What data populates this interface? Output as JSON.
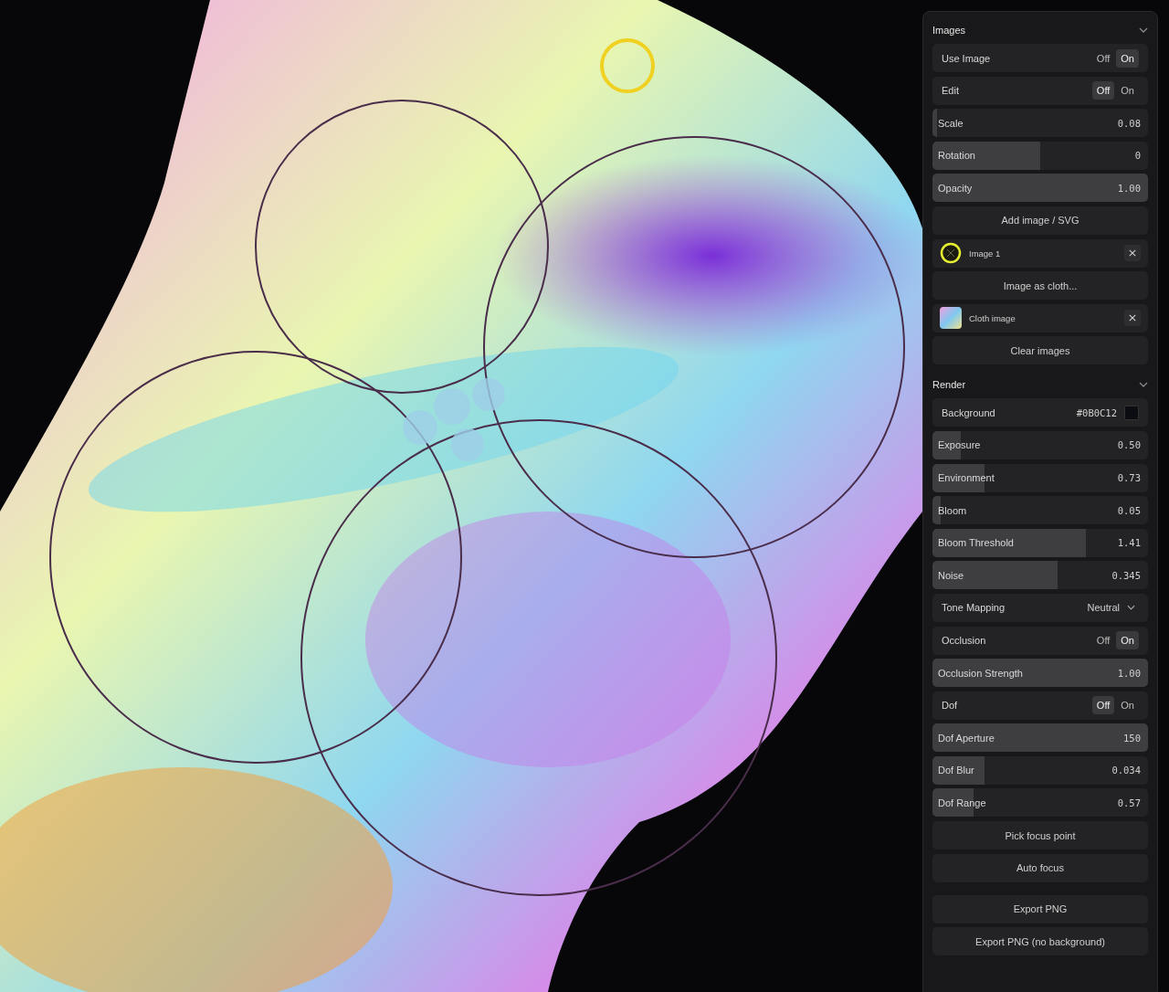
{
  "sections": [
    {
      "title": "Images",
      "expanded": true,
      "items": [
        {
          "kind": "toggle",
          "label": "Use Image",
          "options": [
            {
              "label": "Off",
              "selected": false
            },
            {
              "label": "On",
              "selected": true
            }
          ]
        },
        {
          "kind": "toggle",
          "label": "Edit",
          "options": [
            {
              "label": "Off",
              "selected": true
            },
            {
              "label": "On",
              "selected": false
            }
          ]
        },
        {
          "kind": "slider",
          "label": "Scale",
          "value": "0.08",
          "level": 0.02
        },
        {
          "kind": "slider",
          "label": "Rotation",
          "value": "0",
          "level": 0.5
        },
        {
          "kind": "slider",
          "label": "Opacity",
          "value": "1.00",
          "level": 1
        },
        {
          "kind": "button",
          "label": "Add image / SVG"
        },
        {
          "kind": "file",
          "label": "Image 1",
          "thumbnail": {
            "kind": "ring"
          }
        },
        {
          "kind": "button",
          "label": "Image as cloth..."
        },
        {
          "kind": "file",
          "label": "Cloth image",
          "thumbnail": {
            "kind": "gradient"
          }
        },
        {
          "kind": "button",
          "label": "Clear images"
        }
      ]
    },
    {
      "title": "Render",
      "expanded": true,
      "items": [
        {
          "kind": "color",
          "label": "Background",
          "value": "#0B0C12",
          "color": "#0b0c12"
        },
        {
          "kind": "slider",
          "label": "Exposure",
          "value": "0.50",
          "level": 0.13
        },
        {
          "kind": "slider",
          "label": "Environment",
          "value": "0.73",
          "level": 0.24
        },
        {
          "kind": "slider",
          "label": "Bloom",
          "value": "0.05",
          "level": 0.04
        },
        {
          "kind": "slider",
          "label": "Bloom Threshold",
          "value": "1.41",
          "level": 0.71
        },
        {
          "kind": "slider",
          "label": "Noise",
          "value": "0.345",
          "level": 0.58
        },
        {
          "kind": "select",
          "label": "Tone Mapping",
          "value": "Neutral"
        },
        {
          "kind": "toggle",
          "label": "Occlusion",
          "options": [
            {
              "label": "Off",
              "selected": false
            },
            {
              "label": "On",
              "selected": true
            }
          ]
        },
        {
          "kind": "slider",
          "label": "Occlusion Strength",
          "value": "1.00",
          "level": 1
        },
        {
          "kind": "toggle",
          "label": "Dof",
          "options": [
            {
              "label": "Off",
              "selected": true
            },
            {
              "label": "On",
              "selected": false
            }
          ]
        },
        {
          "kind": "slider",
          "label": "Dof Aperture",
          "value": "150",
          "level": 1
        },
        {
          "kind": "slider",
          "label": "Dof Blur",
          "value": "0.034",
          "level": 0.24
        },
        {
          "kind": "slider",
          "label": "Dof Range",
          "value": "0.57",
          "level": 0.19
        },
        {
          "kind": "button",
          "label": "Pick focus point"
        },
        {
          "kind": "button",
          "label": "Auto focus"
        }
      ]
    }
  ],
  "actions": [
    "Export PNG",
    "Export PNG (no background)"
  ]
}
